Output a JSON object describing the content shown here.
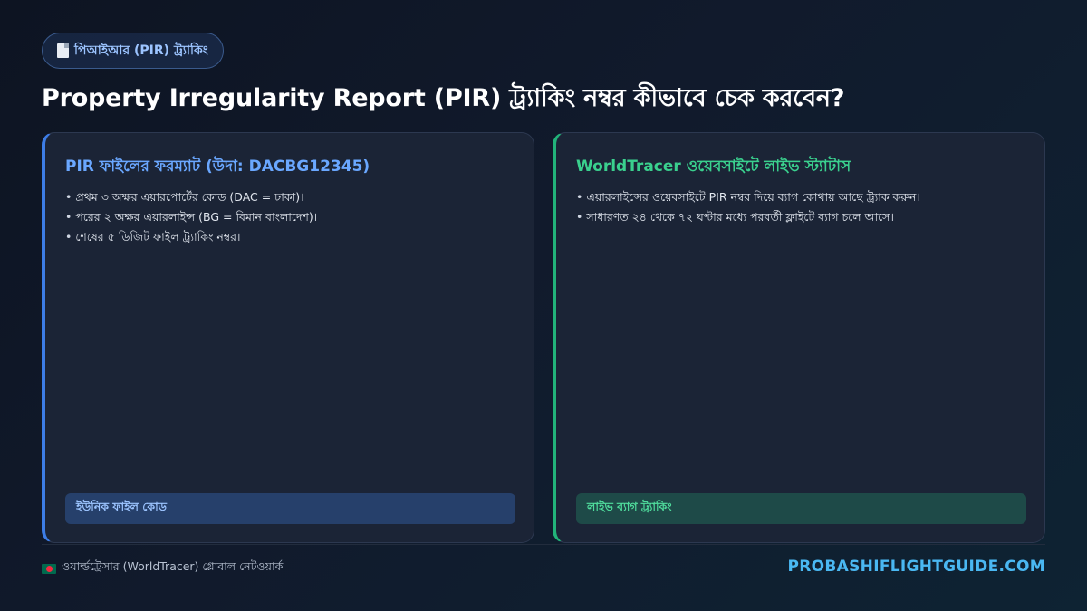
{
  "header": {
    "badge_label": "পিআইআর (PIR) ট্র্যাকিং",
    "badge_icon": "document-icon",
    "title": "Property Irregularity Report (PIR) ট্র্যাকিং নম্বর কীভাবে চেক করবেন?"
  },
  "cards": [
    {
      "title": "PIR ফাইলের ফরম্যাট (উদা: DACBG12345)",
      "accent": "#3d7de6",
      "items": [
        "প্রথম ৩ অক্ষর এয়ারপোর্টের কোড (DAC = ঢাকা)।",
        "পরের ২ অক্ষর এয়ারলাইন্স (BG = বিমান বাংলাদেশ)।",
        "শেষের ৫ ডিজিট ফাইল ট্র্যাকিং নম্বর।"
      ],
      "tag": "ইউনিক ফাইল কোড"
    },
    {
      "title": "WorldTracer ওয়েবসাইটে লাইভ স্ট্যাটাস",
      "accent": "#22b37a",
      "items": [
        "এয়ারলাইন্সের ওয়েবসাইটে PIR নম্বর দিয়ে ব্যাগ কোথায় আছে ট্র্যাক করুন।",
        "সাধারণত ২৪ থেকে ৭২ ঘণ্টার মধ্যে পরবর্তী ফ্লাইটে ব্যাগ চলে আসে।"
      ],
      "tag": "লাইভ ব্যাগ ট্র্যাকিং"
    }
  ],
  "footer": {
    "left_text": "ওয়ার্ল্ডট্রেসার (WorldTracer) গ্লোবাল নেটওয়ার্ক",
    "flag_icon": "bangladesh-flag-icon",
    "brand": "PROBASHIFLIGHTGUIDE.COM"
  }
}
